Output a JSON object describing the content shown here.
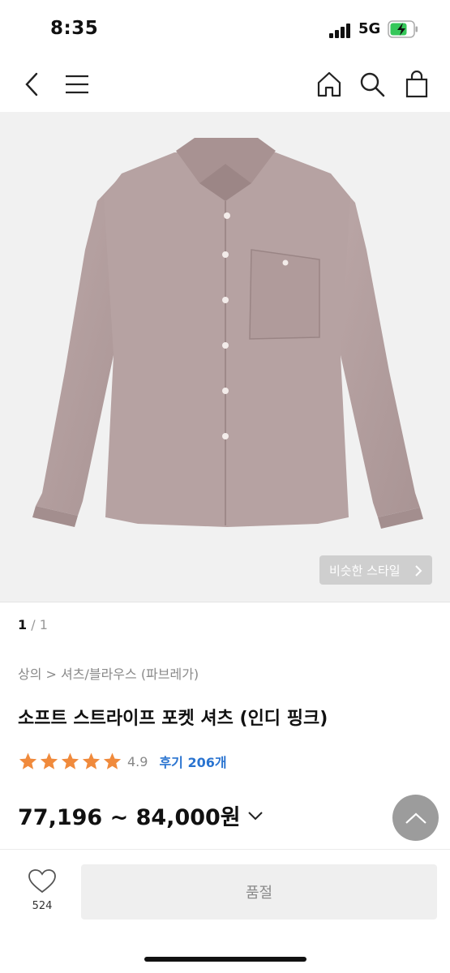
{
  "status_bar": {
    "time": "8:35",
    "network": "5G"
  },
  "nav": {
    "back_icon": "chevron-left-icon",
    "menu_icon": "hamburger-icon",
    "home_icon": "home-icon",
    "search_icon": "search-icon",
    "bag_icon": "shopping-bag-icon"
  },
  "hero": {
    "similar_style_label": "비슷한 스타일"
  },
  "pager": {
    "current": "1",
    "separator": " / ",
    "total": "1"
  },
  "breadcrumb": "상의 > 셔츠/블라우스 (파브레가)",
  "product": {
    "title": "소프트 스트라이프 포켓 셔츠 (인디 핑크)",
    "rating": 4.9,
    "rating_text": "4.9",
    "reviews_label": "후기 206개",
    "price_range": "77,196 ~ 84,000원"
  },
  "bottom_bar": {
    "like_count": "524",
    "soldout_label": "품절"
  },
  "colors": {
    "star": "#f08a3c",
    "review_link": "#2a74d0",
    "shirt": "#b49f9f"
  }
}
